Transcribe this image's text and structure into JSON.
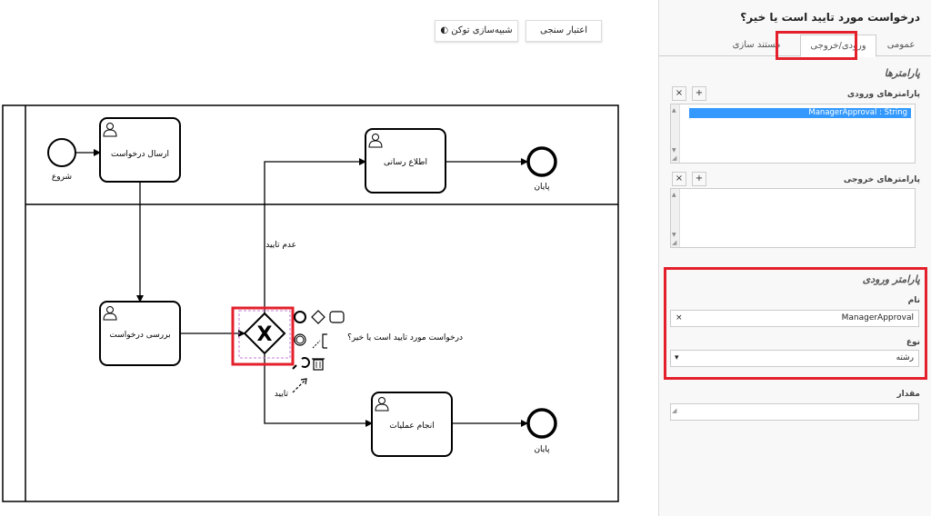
{
  "toolbar": {
    "validate_label": "اعتبار سنجی",
    "simulate_label": "شبیه‌سازی توکن"
  },
  "diagram": {
    "start_label": "شروع",
    "task_submit": "ارسال درخواست",
    "task_review": "بررسی درخواست",
    "task_notify": "اطلاع رسانی",
    "task_operations": "انجام عملیات",
    "end_label_top": "پایان",
    "end_label_bottom": "پایان",
    "gateway_symbol": "X",
    "gateway_label": "درخواست مورد تایید است یا خیر؟",
    "flow_reject": "عدم تایید",
    "flow_approve": "تایید",
    "highlight_color": "#e3202b"
  },
  "panel": {
    "title": "درخواست مورد تایید است یا خیر؟",
    "tabs": [
      "عمومی",
      "ورودی/خروجی",
      "مستند سازی"
    ],
    "active_tab": "ورودی/خروجی",
    "params_heading": "پارامترها",
    "input_params_label": "پارامترهای ورودی",
    "input_params_items": [
      "ManagerApproval : String"
    ],
    "output_params_label": "پارامترهای خروجی",
    "add_symbol": "+",
    "remove_symbol": "×",
    "input_param_heading": "پارامتر ورودی",
    "name_label": "نام",
    "name_value": "ManagerApproval",
    "type_label": "نوع",
    "type_value": "رشته",
    "value_label": "مقدار",
    "value_value": ""
  }
}
